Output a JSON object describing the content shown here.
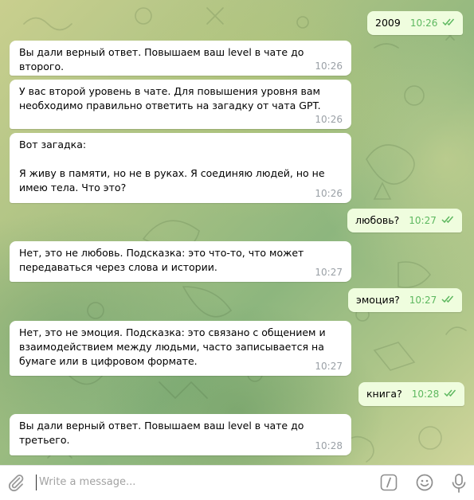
{
  "colors": {
    "incoming_bubble": "#ffffff",
    "outgoing_bubble": "#effdde",
    "outgoing_time": "#5db85f",
    "incoming_time": "#9aa0a6",
    "accent": "#5db85f"
  },
  "messages": [
    {
      "direction": "out",
      "text": "2009",
      "time": "10:26",
      "status": "read"
    },
    {
      "direction": "in",
      "text": "Вы дали верный ответ. Повышаем ваш level в чате до второго.",
      "time": "10:26"
    },
    {
      "direction": "in",
      "text": "У вас второй уровень в чате. Для повышения уровня вам необходимо правильно ответить на загадку от чата GPT.",
      "time": "10:26"
    },
    {
      "direction": "in",
      "text": "Вот загадка:\n\nЯ живу в памяти, но не в руках. Я соединяю людей, но не имею тела. Что это?",
      "time": "10:26"
    },
    {
      "direction": "out",
      "text": "любовь?",
      "time": "10:27",
      "status": "read"
    },
    {
      "direction": "in",
      "text": "Нет, это не любовь. Подсказка: это что-то, что может передаваться через слова и истории.",
      "time": "10:27"
    },
    {
      "direction": "out",
      "text": "эмоция?",
      "time": "10:27",
      "status": "read"
    },
    {
      "direction": "in",
      "text": "Нет, это не эмоция. Подсказка: это связано с общением и взаимодействием между людьми, часто записывается на бумаге или в цифровом формате.",
      "time": "10:27"
    },
    {
      "direction": "out",
      "text": "книга?",
      "time": "10:28",
      "status": "read"
    },
    {
      "direction": "in",
      "text": "Вы дали верный ответ. Повышаем ваш level в чате до третьего.",
      "time": "10:28"
    }
  ],
  "composer": {
    "placeholder": "Write a message...",
    "icons": {
      "attach": "paperclip-icon",
      "commands": "slash-command-icon",
      "emoji": "smile-icon",
      "voice": "microphone-icon"
    }
  }
}
